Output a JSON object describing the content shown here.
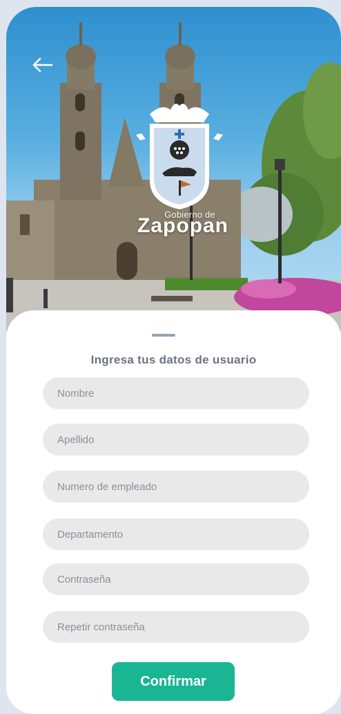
{
  "header": {
    "back_icon": "arrow-left-icon",
    "logo_icon": "zapopan-coat-of-arms-icon",
    "logo_small": "Gobierno de",
    "logo_big": "Zapopan"
  },
  "form": {
    "title": "Ingresa tus datos de usuario",
    "fields": [
      {
        "placeholder": "Nombre"
      },
      {
        "placeholder": "Apellido"
      },
      {
        "placeholder": "Numero de empleado"
      },
      {
        "placeholder": "Departamento"
      },
      {
        "placeholder": "Contraseña"
      },
      {
        "placeholder": "Repetir contraseña"
      }
    ],
    "confirm_label": "Confirmar"
  },
  "colors": {
    "accent": "#1ab694",
    "field_bg": "#e9e9ea",
    "title_text": "#6b7380",
    "page_bg": "#dfe5ef"
  }
}
